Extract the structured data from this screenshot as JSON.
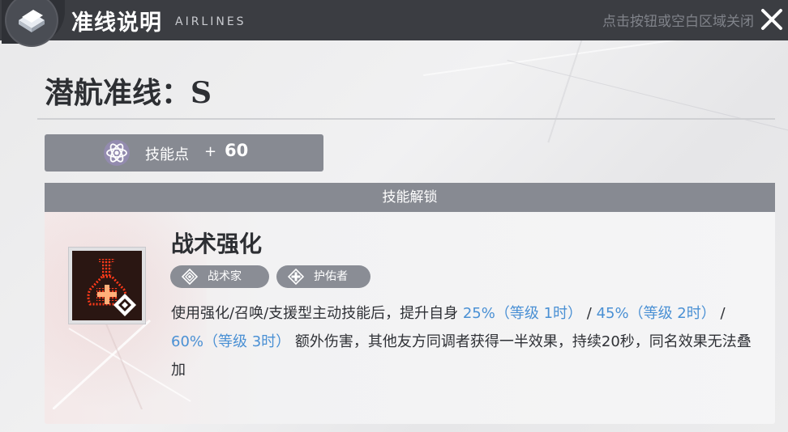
{
  "header": {
    "title": "准线说明",
    "subtitle": "AIRLINES",
    "close_hint": "点击按钮或空白区域关闭"
  },
  "section": {
    "title": "潜航准线：S"
  },
  "skill_points": {
    "label": "技能点",
    "plus": "+",
    "value": "60"
  },
  "unlock": {
    "header": "技能解锁",
    "skill": {
      "name": "战术强化",
      "tags": [
        {
          "label": "战术家",
          "icon": "diamond-emblem-icon"
        },
        {
          "label": "护佑者",
          "icon": "cross-emblem-icon"
        }
      ],
      "description": {
        "p1": "使用强化/召唤/支援型主动技能后，提升自身 ",
        "v1": "25%（等级 1时）",
        "s1": " / ",
        "v2": "45%（等级 2时）",
        "s2": " / ",
        "v3": "60%（等级 3时）",
        "p2": " 额外伤害，其他友方同调者获得一半效果，持续20秒，同名效果无法叠加"
      }
    }
  },
  "colors": {
    "topbar": "#3b3d42",
    "pill": "#878a92",
    "highlight": "#4a90d4",
    "icon_glow": "#ff3a1a"
  }
}
